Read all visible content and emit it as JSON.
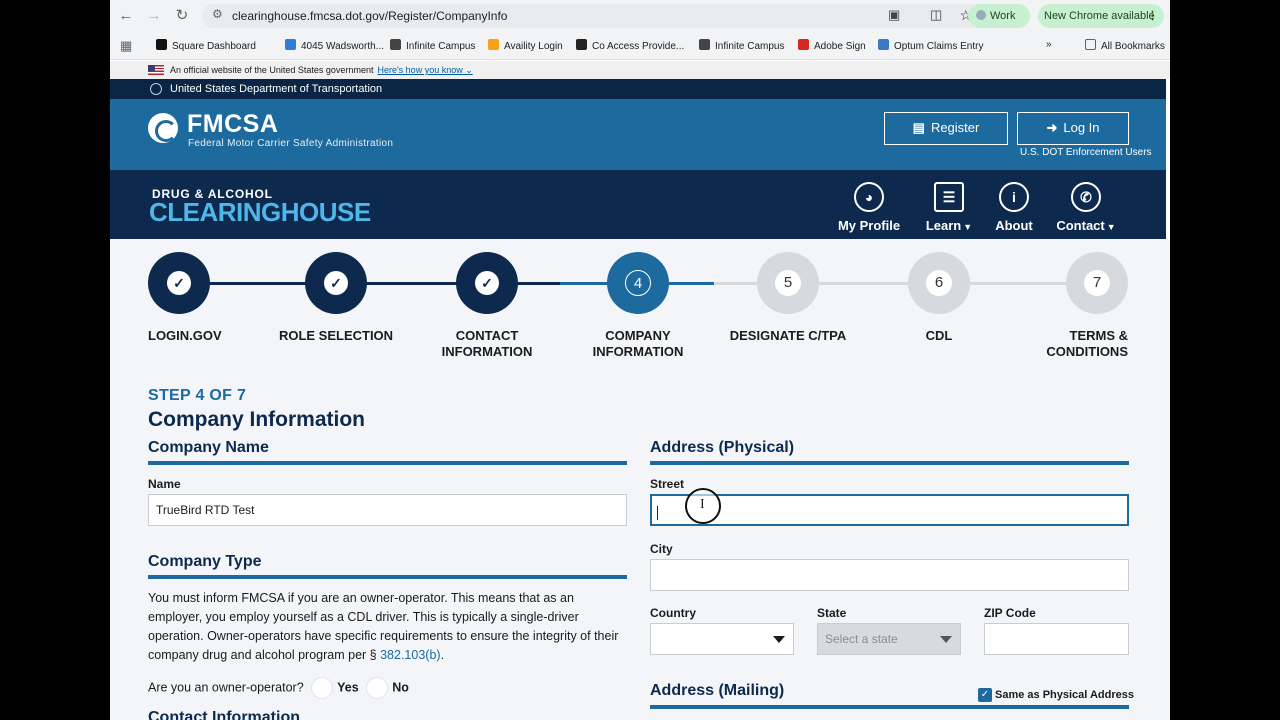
{
  "browser": {
    "url": "clearinghouse.fmcsa.dot.gov/Register/CompanyInfo",
    "profile": "Work",
    "update_label": "New Chrome available",
    "bookmarks": [
      {
        "label": "Square Dashboard",
        "color": "#111111"
      },
      {
        "label": "4045 Wadsworth...",
        "color": "#2e7dd7"
      },
      {
        "label": "Infinite Campus",
        "color": "#444444"
      },
      {
        "label": "Availity Login",
        "color": "#f7a21b"
      },
      {
        "label": "Co Access Provide...",
        "color": "#222222"
      },
      {
        "label": "Infinite Campus",
        "color": "#444444"
      },
      {
        "label": "Adobe Sign",
        "color": "#d6281c"
      },
      {
        "label": "Optum Claims Entry",
        "color": "#3b78c4"
      }
    ],
    "all_bookmarks": "All Bookmarks"
  },
  "gov_banner": {
    "text": "An official website of the United States government",
    "link": "Here's how you know"
  },
  "dot_bar": "United States Department of Transportation",
  "fmcsa": {
    "title": "FMCSA",
    "subtitle": "Federal Motor Carrier Safety Administration",
    "register": "Register",
    "login": "Log In",
    "enforcement": "U.S. DOT Enforcement Users"
  },
  "clearinghouse": {
    "top": "DRUG & ALCOHOL",
    "main": "CLEARINGHOUSE",
    "nav": [
      {
        "label": "My Profile",
        "icon": "gauge-icon"
      },
      {
        "label": "Learn",
        "icon": "book-icon"
      },
      {
        "label": "About",
        "icon": "info-icon"
      },
      {
        "label": "Contact",
        "icon": "phone-chat-icon"
      }
    ]
  },
  "steps": [
    {
      "label": "LOGIN.GOV",
      "state": "done",
      "num": "1"
    },
    {
      "label": "ROLE SELECTION",
      "state": "done",
      "num": "2"
    },
    {
      "label": "CONTACT INFORMATION",
      "state": "done",
      "num": "3"
    },
    {
      "label": "COMPANY INFORMATION",
      "state": "current",
      "num": "4"
    },
    {
      "label": "DESIGNATE C/TPA",
      "state": "todo",
      "num": "5"
    },
    {
      "label": "CDL",
      "state": "todo",
      "num": "6"
    },
    {
      "label": "TERMS & CONDITIONS",
      "state": "todo",
      "num": "7"
    }
  ],
  "form": {
    "step_of": "STEP 4 OF 7",
    "title": "Company Information",
    "company_name_heading": "Company Name",
    "name_label": "Name",
    "name_value": "TrueBird RTD Test",
    "company_type_heading": "Company Type",
    "company_type_text": "You must inform FMCSA if you are an owner-operator. This means that as an employer, you employ yourself as a CDL driver. This is typically a single-driver operation. Owner-operators have specific requirements to ensure the integrity of their company drug and alcohol program per § ",
    "company_type_link": "382.103(b)",
    "owner_question": "Are you an owner-operator?",
    "yes": "Yes",
    "no": "No",
    "contact_heading": "Contact Information",
    "address_heading": "Address (Physical)",
    "street_label": "Street",
    "street_value": "",
    "city_label": "City",
    "city_value": "",
    "country_label": "Country",
    "country_value": "",
    "state_label": "State",
    "state_placeholder": "Select a state",
    "zip_label": "ZIP Code",
    "zip_value": "",
    "mailing_heading": "Address (Mailing)",
    "same_as_physical": "Same as Physical Address",
    "same_as_checked": true
  }
}
